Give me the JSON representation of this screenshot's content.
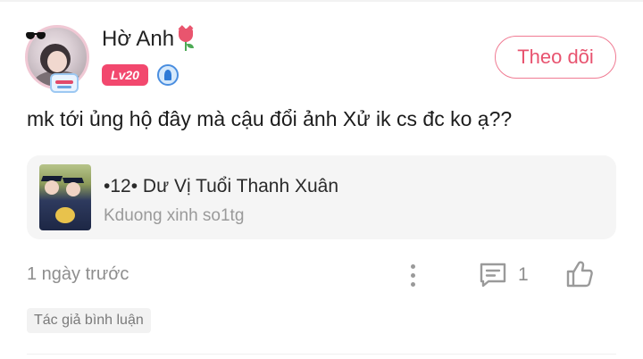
{
  "user": {
    "name": "Hờ Anh",
    "name_emoji_icon": "tulip-icon",
    "level": "Lv20",
    "level_color": "#f2486e",
    "badge_icon": "pen-badge-icon"
  },
  "follow": {
    "label": "Theo dõi",
    "color": "#e8536f"
  },
  "comment": {
    "text": "mk tới ủng hộ đây mà cậu đổi ảnh Xử ik cs đc ko ạ??"
  },
  "linked_post": {
    "title": "•12• Dư Vị Tuổi Thanh Xuân",
    "author": "Kduong xinh so1tg"
  },
  "footer": {
    "timestamp": "1 ngày trước",
    "more_icon": "more-vertical-icon",
    "reply_icon": "comment-icon",
    "reply_count": "1",
    "like_icon": "thumbs-up-icon",
    "author_reply_tag": "Tác giả bình luận"
  }
}
